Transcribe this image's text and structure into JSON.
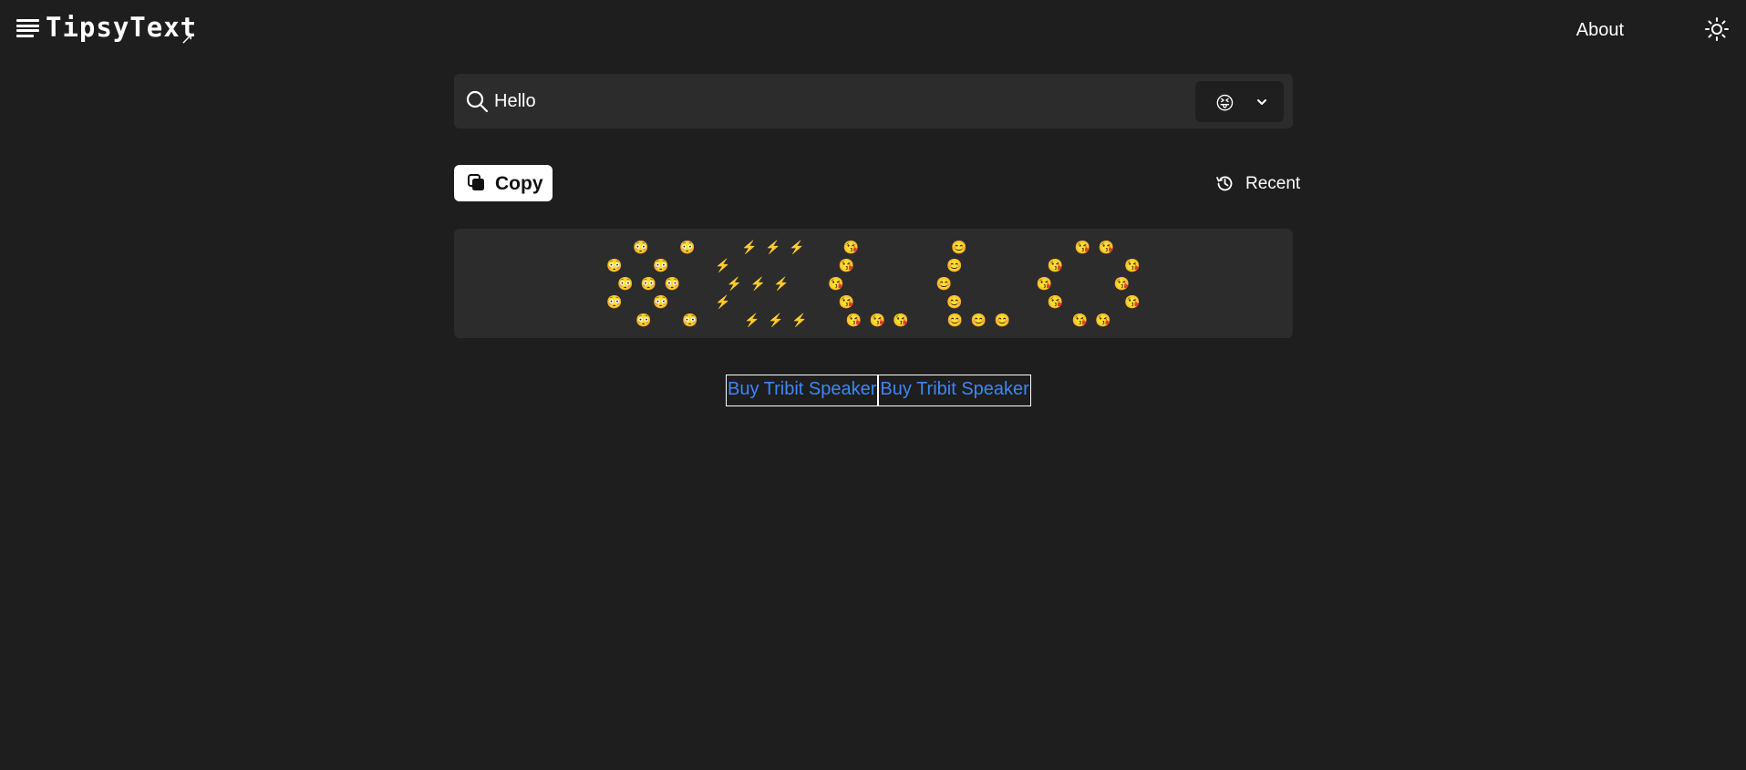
{
  "header": {
    "logo_text": "TipsyText",
    "logo_arrow": "↗",
    "about_label": "About"
  },
  "search": {
    "value": "Hello",
    "selected_emoji": "😝"
  },
  "toolbar": {
    "copy_label": "Copy",
    "recent_label": "Recent"
  },
  "output": {
    "emoji_art": "😳    😳      ⚡️ ⚡️ ⚡️     😘            😊              😘 😘\n😳    😳      ⚡️              😘            😊           😘        😘\n😳 😳 😳      ⚡️ ⚡️ ⚡️     😘            😊           😘        😘\n😳    😳      ⚡️              😘            😊           😘        😘\n😳    😳      ⚡️ ⚡️ ⚡️     😘 😘 😘     😊 😊 😊        😘 😘"
  },
  "ads": [
    {
      "label": "Buy Tribit Speaker"
    },
    {
      "label": "Buy Tribit Speaker"
    }
  ],
  "colors": {
    "background": "#1e1e1e",
    "panel": "#2c2c2c",
    "link": "#3f86f5"
  },
  "icons": [
    "menu-icon",
    "sun-icon",
    "search-icon",
    "chevron-down-icon",
    "copy-icon",
    "history-icon"
  ]
}
